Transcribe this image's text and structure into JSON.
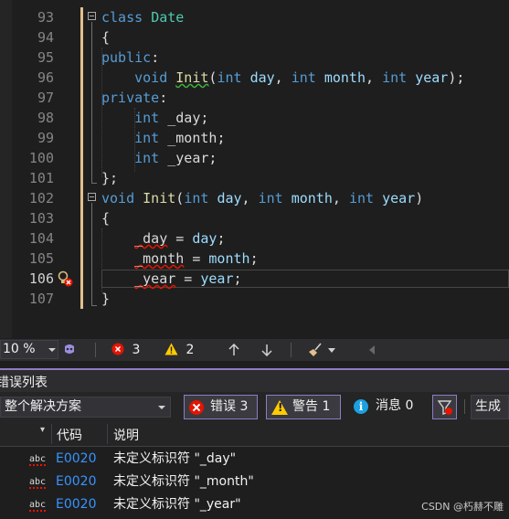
{
  "editor": {
    "lines": [
      {
        "num": "93",
        "tokens": [
          {
            "t": "class",
            "c": "kw"
          },
          {
            "t": " ",
            "c": "txt"
          },
          {
            "t": "Date",
            "c": "ty"
          }
        ]
      },
      {
        "num": "94",
        "tokens": [
          {
            "t": "{",
            "c": "txt"
          }
        ]
      },
      {
        "num": "95",
        "tokens": [
          {
            "t": "public",
            "c": "kw"
          },
          {
            "t": ":",
            "c": "txt"
          }
        ]
      },
      {
        "num": "96",
        "tokens": [
          {
            "t": "    ",
            "c": "txt"
          },
          {
            "t": "void",
            "c": "kw"
          },
          {
            "t": " ",
            "c": "txt"
          },
          {
            "t": "Init",
            "c": "fn",
            "u": "g"
          },
          {
            "t": "(",
            "c": "txt"
          },
          {
            "t": "int",
            "c": "kw"
          },
          {
            "t": " ",
            "c": "txt"
          },
          {
            "t": "day",
            "c": "pr"
          },
          {
            "t": ", ",
            "c": "txt"
          },
          {
            "t": "int",
            "c": "kw"
          },
          {
            "t": " ",
            "c": "txt"
          },
          {
            "t": "month",
            "c": "pr"
          },
          {
            "t": ", ",
            "c": "txt"
          },
          {
            "t": "int",
            "c": "kw"
          },
          {
            "t": " ",
            "c": "txt"
          },
          {
            "t": "year",
            "c": "pr"
          },
          {
            "t": ");",
            "c": "txt"
          }
        ]
      },
      {
        "num": "97",
        "tokens": [
          {
            "t": "private",
            "c": "kw"
          },
          {
            "t": ":",
            "c": "txt"
          }
        ]
      },
      {
        "num": "98",
        "tokens": [
          {
            "t": "    ",
            "c": "txt"
          },
          {
            "t": "int",
            "c": "kw"
          },
          {
            "t": " ",
            "c": "txt"
          },
          {
            "t": "_day",
            "c": "fld"
          },
          {
            "t": ";",
            "c": "txt"
          }
        ]
      },
      {
        "num": "99",
        "tokens": [
          {
            "t": "    ",
            "c": "txt"
          },
          {
            "t": "int",
            "c": "kw"
          },
          {
            "t": " ",
            "c": "txt"
          },
          {
            "t": "_month",
            "c": "fld"
          },
          {
            "t": ";",
            "c": "txt"
          }
        ]
      },
      {
        "num": "100",
        "tokens": [
          {
            "t": "    ",
            "c": "txt"
          },
          {
            "t": "int",
            "c": "kw"
          },
          {
            "t": " ",
            "c": "txt"
          },
          {
            "t": "_year",
            "c": "fld"
          },
          {
            "t": ";",
            "c": "txt"
          }
        ]
      },
      {
        "num": "101",
        "tokens": [
          {
            "t": "};",
            "c": "txt"
          }
        ]
      },
      {
        "num": "102",
        "tokens": [
          {
            "t": "void",
            "c": "kw"
          },
          {
            "t": " ",
            "c": "txt"
          },
          {
            "t": "Init",
            "c": "fn"
          },
          {
            "t": "(",
            "c": "txt"
          },
          {
            "t": "int",
            "c": "kw"
          },
          {
            "t": " ",
            "c": "txt"
          },
          {
            "t": "day",
            "c": "pr"
          },
          {
            "t": ", ",
            "c": "txt"
          },
          {
            "t": "int",
            "c": "kw"
          },
          {
            "t": " ",
            "c": "txt"
          },
          {
            "t": "month",
            "c": "pr"
          },
          {
            "t": ", ",
            "c": "txt"
          },
          {
            "t": "int",
            "c": "kw"
          },
          {
            "t": " ",
            "c": "txt"
          },
          {
            "t": "year",
            "c": "pr"
          },
          {
            "t": ")",
            "c": "txt"
          }
        ]
      },
      {
        "num": "103",
        "tokens": [
          {
            "t": "{",
            "c": "txt"
          }
        ]
      },
      {
        "num": "104",
        "tokens": [
          {
            "t": "    ",
            "c": "txt"
          },
          {
            "t": "_day",
            "c": "fld",
            "u": "r"
          },
          {
            "t": " = ",
            "c": "txt"
          },
          {
            "t": "day",
            "c": "pr"
          },
          {
            "t": ";",
            "c": "txt"
          }
        ]
      },
      {
        "num": "105",
        "tokens": [
          {
            "t": "    ",
            "c": "txt"
          },
          {
            "t": "_month",
            "c": "fld",
            "u": "r"
          },
          {
            "t": " = ",
            "c": "txt"
          },
          {
            "t": "month",
            "c": "pr"
          },
          {
            "t": ";",
            "c": "txt"
          }
        ]
      },
      {
        "num": "106",
        "current": true,
        "tokens": [
          {
            "t": "    ",
            "c": "txt"
          },
          {
            "t": "_year",
            "c": "fld",
            "u": "r"
          },
          {
            "t": " = ",
            "c": "txt"
          },
          {
            "t": "year",
            "c": "pr"
          },
          {
            "t": ";",
            "c": "txt"
          }
        ]
      },
      {
        "num": "107",
        "tokens": [
          {
            "t": "}",
            "c": "txt"
          }
        ]
      }
    ]
  },
  "status_strip": {
    "zoom": "10 %",
    "error_count": "3",
    "warning_count": "2"
  },
  "error_list": {
    "title": "错误列表",
    "scope": "整个解决方案",
    "errors_label": "错误 3",
    "warnings_label": "警告 1",
    "messages_label": "消息 0",
    "build_label": "生成",
    "col_code": "代码",
    "col_desc": "说明",
    "rows": [
      {
        "icon": "abc",
        "code": "E0020",
        "desc": "未定义标识符 \"_day\""
      },
      {
        "icon": "abc",
        "code": "E0020",
        "desc": "未定义标识符 \"_month\""
      },
      {
        "icon": "abc",
        "code": "E0020",
        "desc": "未定义标识符 \"_year\""
      }
    ]
  },
  "watermark": "CSDN @朽赫不雕",
  "colors": {
    "keyword": "#569cd6",
    "type": "#4ec9b0",
    "function": "#dcdcaa",
    "param": "#9cdcfe",
    "error": "#e51400",
    "warning": "#ffcc00",
    "accent": "#8e7cc3",
    "link": "#3794ff"
  }
}
